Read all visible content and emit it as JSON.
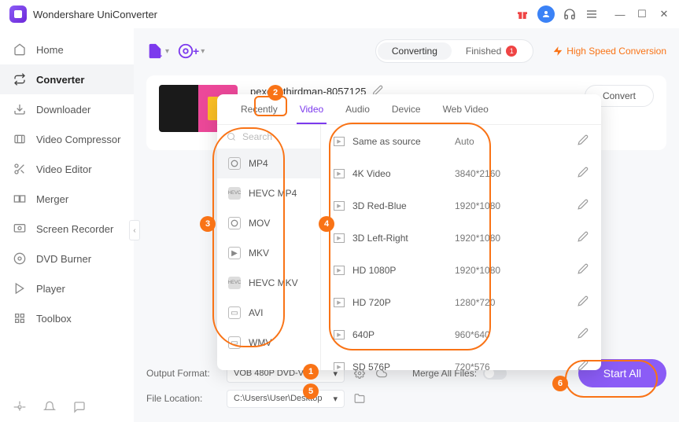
{
  "app_title": "Wondershare UniConverter",
  "sidebar": {
    "items": [
      {
        "label": "Home",
        "icon": "home-icon"
      },
      {
        "label": "Converter",
        "icon": "converter-icon",
        "active": true
      },
      {
        "label": "Downloader",
        "icon": "downloader-icon"
      },
      {
        "label": "Video Compressor",
        "icon": "compressor-icon"
      },
      {
        "label": "Video Editor",
        "icon": "editor-icon"
      },
      {
        "label": "Merger",
        "icon": "merger-icon"
      },
      {
        "label": "Screen Recorder",
        "icon": "recorder-icon"
      },
      {
        "label": "DVD Burner",
        "icon": "burner-icon"
      },
      {
        "label": "Player",
        "icon": "player-icon"
      },
      {
        "label": "Toolbox",
        "icon": "toolbox-icon"
      }
    ]
  },
  "top_tabs": {
    "converting": "Converting",
    "finished": "Finished",
    "finished_count": "1"
  },
  "high_speed": "High Speed Conversion",
  "file": {
    "name": "pexels-thirdman-8057125"
  },
  "convert_button": "Convert",
  "dropdown": {
    "tabs": {
      "recently": "Recently",
      "video": "Video",
      "audio": "Audio",
      "device": "Device",
      "web_video": "Web Video"
    },
    "search_placeholder": "Search",
    "formats": [
      {
        "label": "MP4",
        "active": true
      },
      {
        "label": "HEVC MP4"
      },
      {
        "label": "MOV"
      },
      {
        "label": "MKV"
      },
      {
        "label": "HEVC MKV"
      },
      {
        "label": "AVI"
      },
      {
        "label": "WMV"
      }
    ],
    "presets": [
      {
        "label": "Same as source",
        "resolution": "Auto"
      },
      {
        "label": "4K Video",
        "resolution": "3840*2160"
      },
      {
        "label": "3D Red-Blue",
        "resolution": "1920*1080"
      },
      {
        "label": "3D Left-Right",
        "resolution": "1920*1080"
      },
      {
        "label": "HD 1080P",
        "resolution": "1920*1080"
      },
      {
        "label": "HD 720P",
        "resolution": "1280*720"
      },
      {
        "label": "640P",
        "resolution": "960*640"
      },
      {
        "label": "SD 576P",
        "resolution": "720*576"
      }
    ]
  },
  "bottom": {
    "output_format_label": "Output Format:",
    "output_format_value": "VOB 480P DVD-Vi...",
    "file_location_label": "File Location:",
    "file_location_value": "C:\\Users\\User\\Desktop",
    "merge_label": "Merge All Files:",
    "start_button": "Start All"
  },
  "callouts": {
    "c1": "1",
    "c2": "2",
    "c3": "3",
    "c4": "4",
    "c5": "5",
    "c6": "6"
  }
}
